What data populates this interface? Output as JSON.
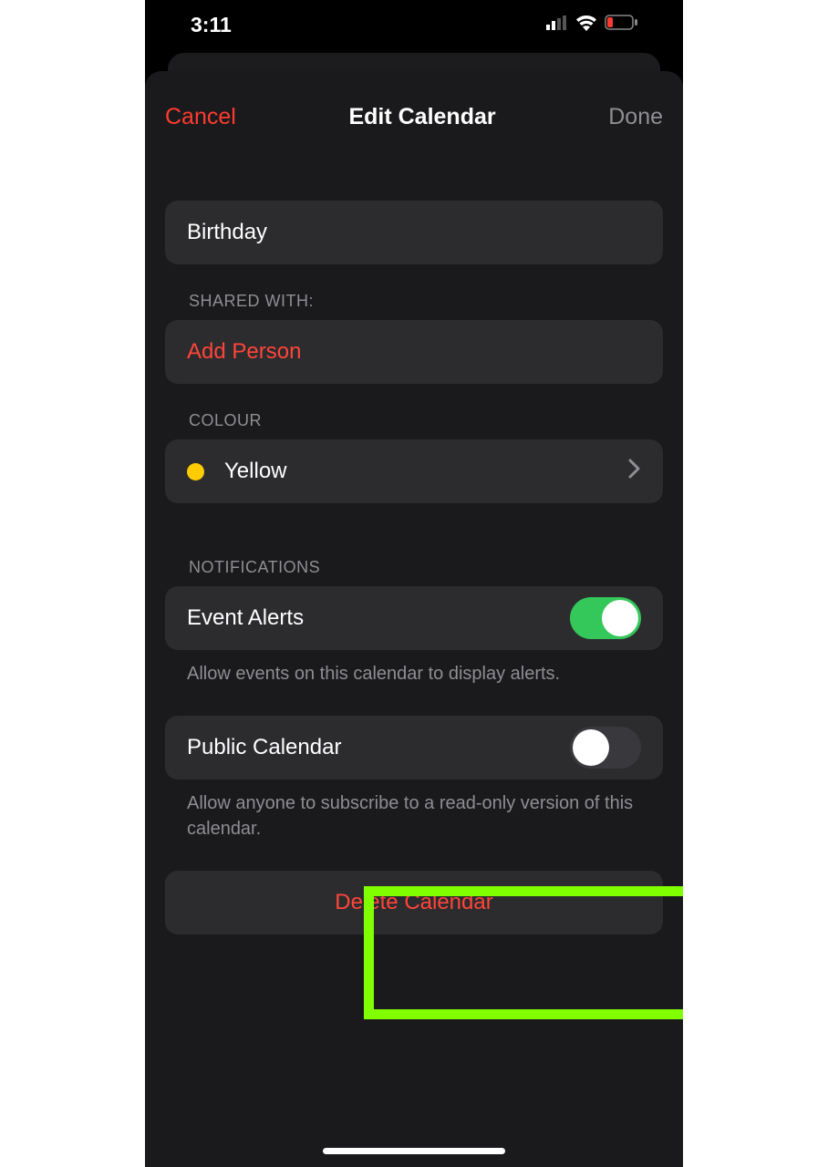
{
  "status": {
    "time": "3:11"
  },
  "nav": {
    "cancel": "Cancel",
    "title": "Edit Calendar",
    "done": "Done"
  },
  "calendar_name": "Birthday",
  "sections": {
    "shared_with_header": "SHARED WITH:",
    "add_person": "Add Person",
    "colour_header": "COLOUR",
    "colour_value": "Yellow",
    "colour_hex": "#ffcc00",
    "notifications_header": "NOTIFICATIONS",
    "event_alerts_label": "Event Alerts",
    "event_alerts_on": true,
    "event_alerts_caption": "Allow events on this calendar to display alerts.",
    "public_label": "Public Calendar",
    "public_on": false,
    "public_caption": "Allow anyone to subscribe to a read-only version of this calendar."
  },
  "delete_label": "Delete Calendar"
}
